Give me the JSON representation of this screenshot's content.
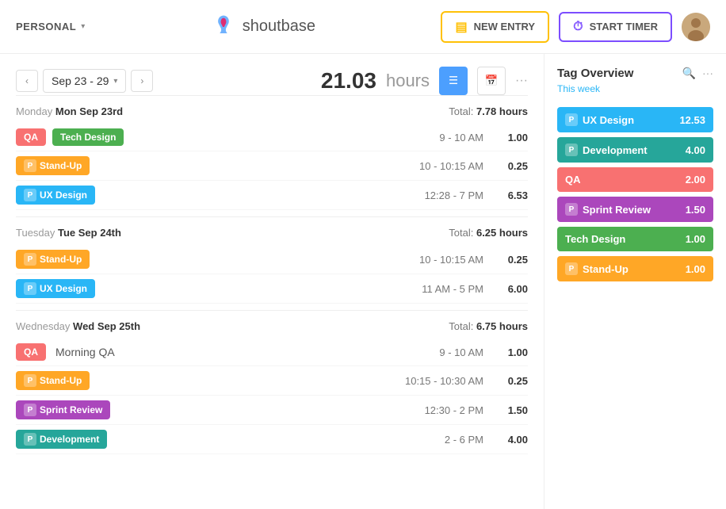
{
  "header": {
    "personal_label": "PERSONAL",
    "logo_text": "shoutbase",
    "new_entry_label": "NEW ENTRY",
    "start_timer_label": "START TIMER"
  },
  "week": {
    "range": "Sep 23 - 29",
    "total_hours": "21.03",
    "hours_unit": "hours"
  },
  "days": [
    {
      "day_name": "Monday",
      "date_label": "Mon Sep 23rd",
      "total_label": "Total:",
      "total_hours": "7.78 hours",
      "entries": [
        {
          "tags": [
            "QA",
            "Tech Design"
          ],
          "tag_types": [
            "qa",
            "tech-design"
          ],
          "has_p": [
            false,
            false
          ],
          "time": "9 - 10 AM",
          "duration": "1.00"
        },
        {
          "tags": [
            "Stand-Up"
          ],
          "tag_types": [
            "stand-up"
          ],
          "has_p": [
            true
          ],
          "time": "10 - 10:15 AM",
          "duration": "0.25"
        },
        {
          "tags": [
            "UX Design"
          ],
          "tag_types": [
            "ux-design"
          ],
          "has_p": [
            true
          ],
          "time": "12:28 - 7 PM",
          "duration": "6.53"
        }
      ]
    },
    {
      "day_name": "Tuesday",
      "date_label": "Tue Sep 24th",
      "total_label": "Total:",
      "total_hours": "6.25 hours",
      "entries": [
        {
          "tags": [
            "Stand-Up"
          ],
          "tag_types": [
            "stand-up"
          ],
          "has_p": [
            true
          ],
          "time": "10 - 10:15 AM",
          "duration": "0.25"
        },
        {
          "tags": [
            "UX Design"
          ],
          "tag_types": [
            "ux-design"
          ],
          "has_p": [
            true
          ],
          "time": "11 AM - 5 PM",
          "duration": "6.00"
        }
      ]
    },
    {
      "day_name": "Wednesday",
      "date_label": "Wed Sep 25th",
      "total_label": "Total:",
      "total_hours": "6.75 hours",
      "entries": [
        {
          "tags": [
            "QA"
          ],
          "tag_types": [
            "qa"
          ],
          "has_p": [
            false
          ],
          "description": "Morning QA",
          "time": "9 - 10 AM",
          "duration": "1.00"
        },
        {
          "tags": [
            "Stand-Up"
          ],
          "tag_types": [
            "stand-up"
          ],
          "has_p": [
            true
          ],
          "time": "10:15 - 10:30 AM",
          "duration": "0.25"
        },
        {
          "tags": [
            "Sprint Review"
          ],
          "tag_types": [
            "sprint-review"
          ],
          "has_p": [
            true
          ],
          "time": "12:30 - 2 PM",
          "duration": "1.50"
        },
        {
          "tags": [
            "Development"
          ],
          "tag_types": [
            "development"
          ],
          "has_p": [
            true
          ],
          "time": "2 - 6 PM",
          "duration": "4.00"
        }
      ]
    }
  ],
  "sidebar": {
    "title": "Tag Overview",
    "subtitle": "This week",
    "items": [
      {
        "name": "UX Design",
        "value": "12.53",
        "type": "ux",
        "has_p": true
      },
      {
        "name": "Development",
        "value": "4.00",
        "type": "dev",
        "has_p": true
      },
      {
        "name": "QA",
        "value": "2.00",
        "type": "qa-tag",
        "has_p": false
      },
      {
        "name": "Sprint Review",
        "value": "1.50",
        "type": "sprint",
        "has_p": true
      },
      {
        "name": "Tech Design",
        "value": "1.00",
        "type": "techd",
        "has_p": false
      },
      {
        "name": "Stand-Up",
        "value": "1.00",
        "type": "standup",
        "has_p": true
      }
    ]
  },
  "icons": {
    "new_entry": "▤",
    "timer": "⏱",
    "list_view": "☰",
    "calendar_view": "📅",
    "more": "···",
    "search": "🔍",
    "chevron_left": "‹",
    "chevron_right": "›",
    "caret_down": "▾",
    "p_badge": "P"
  }
}
